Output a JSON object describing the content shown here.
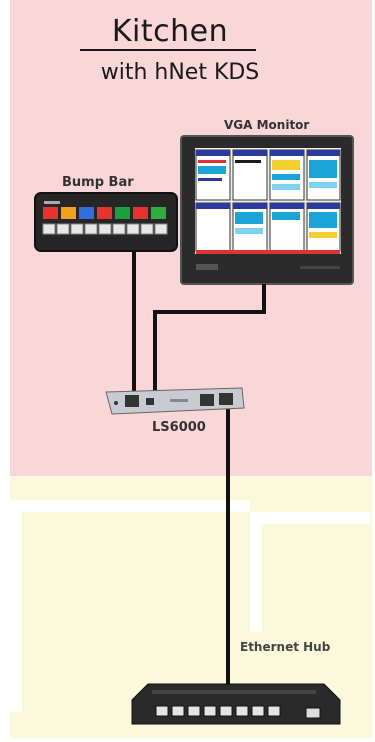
{
  "diagram": {
    "title": "Kitchen",
    "subtitle": "with hNet KDS",
    "devices": {
      "monitor": {
        "label": "VGA Monitor"
      },
      "bump_bar": {
        "label": "Bump Bar",
        "key_colors": [
          "#e8322e",
          "#f2a11a",
          "#2f6fe0",
          "#e8322e",
          "#19a23b",
          "#e8322e",
          "#2fae3a"
        ]
      },
      "controller": {
        "label": "LS6000"
      },
      "hub": {
        "label": "Ethernet Hub"
      }
    },
    "colors": {
      "kitchen_zone": "#f9d6d8",
      "outer_zone": "#fbf8dc",
      "cable": "#111111",
      "device_dark": "#2a2a2a"
    }
  }
}
